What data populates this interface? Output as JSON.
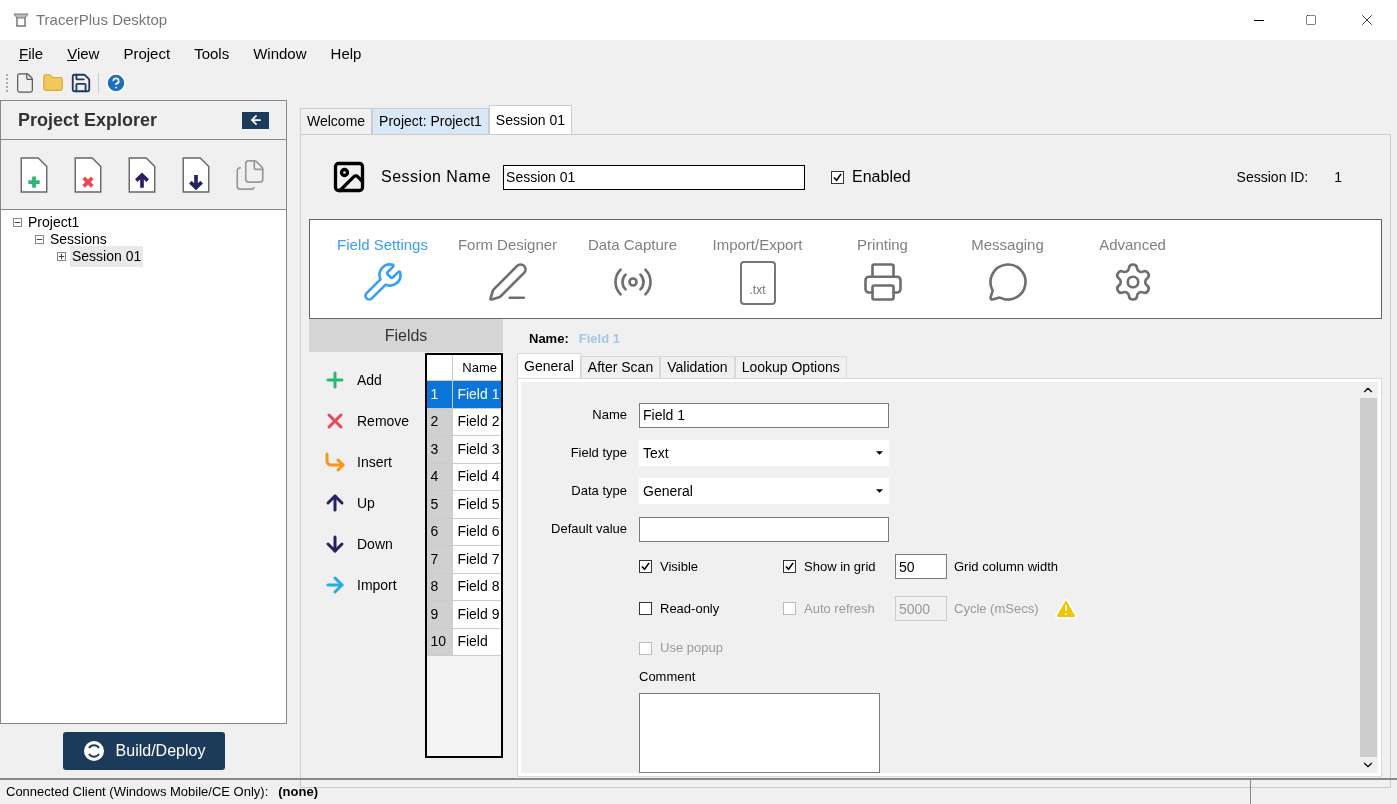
{
  "window": {
    "title": "TracerPlus Desktop"
  },
  "menu": [
    {
      "label": "File",
      "underlined": true
    },
    {
      "label": "View",
      "underlined": true
    },
    {
      "label": "Project",
      "underlined": false
    },
    {
      "label": "Tools",
      "underlined": false
    },
    {
      "label": "Window",
      "underlined": false
    },
    {
      "label": "Help",
      "underlined": false
    }
  ],
  "project_explorer": {
    "title": "Project Explorer",
    "tree": [
      {
        "label": "Project1",
        "expanded": true,
        "children": [
          {
            "label": "Sessions",
            "expanded": true,
            "children": [
              {
                "label": "Session 01",
                "expanded": false,
                "selected": true
              }
            ]
          }
        ]
      }
    ],
    "build_button": "Build/Deploy"
  },
  "tabs": [
    {
      "label": "Welcome",
      "selected": false
    },
    {
      "label": "Project: Project1",
      "selected": false
    },
    {
      "label": "Session 01",
      "selected": true
    }
  ],
  "session": {
    "name_label": "Session Name",
    "name_value": "Session 01",
    "enabled_label": "Enabled",
    "enabled": true,
    "id_label": "Session ID:",
    "id_value": "1"
  },
  "categories": [
    {
      "label": "Field Settings",
      "kind": "wrench",
      "selected": true
    },
    {
      "label": "Form Designer",
      "kind": "pencil",
      "selected": false
    },
    {
      "label": "Data Capture",
      "kind": "signal",
      "selected": false
    },
    {
      "label": "Import/Export",
      "kind": "file",
      "icon_text": ".txt",
      "selected": false
    },
    {
      "label": "Printing",
      "kind": "printer",
      "selected": false
    },
    {
      "label": "Messaging",
      "kind": "chat",
      "selected": false
    },
    {
      "label": "Advanced",
      "kind": "gear",
      "selected": false
    }
  ],
  "fields": {
    "title": "Fields",
    "actions": [
      {
        "label": "Add",
        "kind": "add"
      },
      {
        "label": "Remove",
        "kind": "remove"
      },
      {
        "label": "Insert",
        "kind": "insert"
      },
      {
        "label": "Up",
        "kind": "up"
      },
      {
        "label": "Down",
        "kind": "down"
      },
      {
        "label": "Import",
        "kind": "import"
      }
    ],
    "grid_header": "Name",
    "rows": [
      {
        "number": "1",
        "name": "Field 1",
        "selected": true
      },
      {
        "number": "2",
        "name": "Field 2",
        "selected": false
      },
      {
        "number": "3",
        "name": "Field 3",
        "selected": false
      },
      {
        "number": "4",
        "name": "Field 4",
        "selected": false
      },
      {
        "number": "5",
        "name": "Field 5",
        "selected": false
      },
      {
        "number": "6",
        "name": "Field 6",
        "selected": false
      },
      {
        "number": "7",
        "name": "Field 7",
        "selected": false
      },
      {
        "number": "8",
        "name": "Field 8",
        "selected": false
      },
      {
        "number": "9",
        "name": "Field 9",
        "selected": false
      },
      {
        "number": "10",
        "name": "Field",
        "selected": false
      }
    ]
  },
  "detail": {
    "name_label": "Name:",
    "name_value": "Field 1",
    "tabs": [
      {
        "label": "General",
        "selected": true
      },
      {
        "label": "After Scan",
        "selected": false
      },
      {
        "label": "Validation",
        "selected": false
      },
      {
        "label": "Lookup Options",
        "selected": false
      }
    ],
    "inputs": [
      {
        "label": "Name",
        "kind": "text",
        "value": "Field 1"
      },
      {
        "label": "Field type",
        "kind": "select",
        "value": "Text"
      },
      {
        "label": "Data type",
        "kind": "select",
        "value": "General"
      },
      {
        "label": "Default value",
        "kind": "text"
      }
    ],
    "visible": {
      "label": "Visible",
      "checked": true
    },
    "show_in_grid": {
      "label": "Show in grid",
      "checked": true
    },
    "grid_width": {
      "value": "50",
      "label": "Grid column width"
    },
    "read_only": {
      "label": "Read-only",
      "checked": false
    },
    "auto_refresh": {
      "label": "Auto refresh",
      "checked": false,
      "disabled": true
    },
    "cycle": {
      "value": "5000",
      "label": "Cycle (mSecs)",
      "disabled": true
    },
    "use_popup": {
      "label": "Use popup",
      "checked": false,
      "disabled": true
    },
    "comment_label": "Comment"
  },
  "status_bar": {
    "label": "Connected Client (Windows Mobile/CE Only):",
    "value": "(none)"
  }
}
